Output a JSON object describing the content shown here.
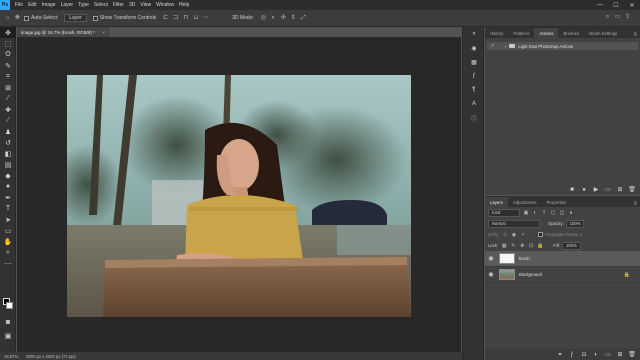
{
  "menu": {
    "logo": "Ps",
    "items": [
      "File",
      "Edit",
      "Image",
      "Layer",
      "Type",
      "Select",
      "Filter",
      "3D",
      "View",
      "Window",
      "Help"
    ],
    "window_controls": [
      "—",
      "☐",
      "✕"
    ]
  },
  "options": {
    "auto_select_label": "Auto-Select:",
    "auto_select_value": "Layer",
    "show_transform_label": "Show Transform Controls",
    "mode_3d_label": "3D Mode:"
  },
  "document": {
    "tab_label": "image.jpg @ 16.7% (brush, RGB/8) *",
    "close_symbol": "×"
  },
  "status": {
    "zoom": "16.67%",
    "doc_info": "6000 px x 4000 px (72 ppi)"
  },
  "top_panel": {
    "tabs": [
      "History",
      "Patterns",
      "Actions",
      "Brushes",
      "Brush Settings"
    ],
    "active_tab": "Actions",
    "action_set_name": "Light Dust Photoshop Actions"
  },
  "layers_panel": {
    "tabs": [
      "Layers",
      "Adjustments",
      "Properties"
    ],
    "active_tab": "Layers",
    "filter_kind": "Kind",
    "blend_mode": "Normal",
    "opacity_label": "Opacity:",
    "opacity_value": "100%",
    "unify_label": "Unify:",
    "propagate_label": "Propagate Frame 1",
    "lock_label": "Lock:",
    "fill_label": "Fill:",
    "fill_value": "100%",
    "layers": [
      {
        "name": "brush",
        "selected": true
      },
      {
        "name": "Background",
        "selected": false
      }
    ]
  },
  "colors": {
    "accent": "#31a8ff",
    "panel": "#424242",
    "canvas_bg": "#282828"
  }
}
